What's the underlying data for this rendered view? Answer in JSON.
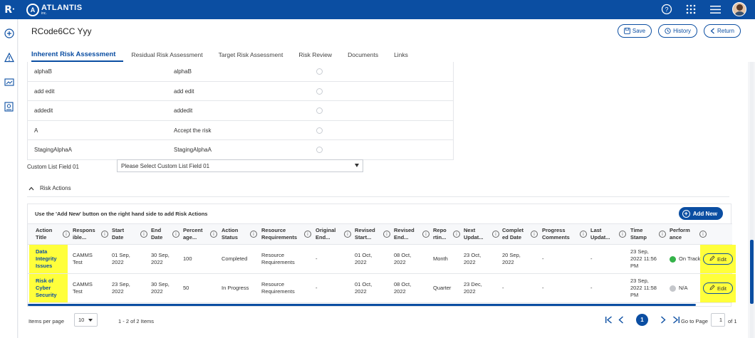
{
  "topbar": {
    "r_logo": "R",
    "brand_name": "ATLANTIS",
    "brand_sub": "inc.",
    "icons": [
      "help-icon",
      "apps-grid-icon",
      "menu-icon",
      "user-avatar"
    ]
  },
  "leftrail": {
    "icons": [
      "add-icon",
      "alert-icon",
      "chart-icon",
      "report-icon"
    ]
  },
  "header": {
    "title": "RCode6CC Yyy",
    "buttons": {
      "save": "Save",
      "history": "History",
      "return": "Return"
    }
  },
  "tabs": [
    {
      "label": "Inherent Risk Assessment",
      "active": true
    },
    {
      "label": "Residual Risk Assessment",
      "active": false
    },
    {
      "label": "Target Risk Assessment",
      "active": false
    },
    {
      "label": "Risk Review",
      "active": false
    },
    {
      "label": "Documents",
      "active": false
    },
    {
      "label": "Links",
      "active": false
    }
  ],
  "list_rows": [
    {
      "c1": "alphaB",
      "c2": "alphaB"
    },
    {
      "c1": "add edit",
      "c2": "add edit"
    },
    {
      "c1": "addedit",
      "c2": "addedit"
    },
    {
      "c1": "A",
      "c2": "Accept the risk"
    },
    {
      "c1": "StagingAlphaA",
      "c2": "StagingAlphaA"
    }
  ],
  "custom_field": {
    "label": "Custom List Field 01",
    "placeholder": "Please Select Custom List Field 01"
  },
  "risk_actions": {
    "section_title": "Risk Actions",
    "hint": "Use the 'Add New' button on the right hand side to add Risk Actions",
    "add_new_label": "Add New",
    "columns": [
      "Action Title",
      "Responsible...",
      "Start Date",
      "End Date",
      "Percentage...",
      "Action Status",
      "Resource Requirements",
      "Original End...",
      "Revised Start...",
      "Revised End...",
      "Reporting...",
      "Next Updat...",
      "Completed Date",
      "Progress Comments",
      "Last Updat...",
      "Time Stamp",
      "Performance"
    ],
    "column_lines": [
      [
        "Action",
        "Title"
      ],
      [
        "Respons",
        "ible..."
      ],
      [
        "Start",
        "Date"
      ],
      [
        "End",
        "Date"
      ],
      [
        "Percent",
        "age..."
      ],
      [
        "Action",
        "Status"
      ],
      [
        "Resource",
        "Requirements"
      ],
      [
        "Original",
        "End..."
      ],
      [
        "Revised",
        "Start..."
      ],
      [
        "Revised",
        "End..."
      ],
      [
        "Repo",
        "rtin..."
      ],
      [
        "Next",
        "Updat..."
      ],
      [
        "Complet",
        "ed Date"
      ],
      [
        "Progress",
        "Comments"
      ],
      [
        "Last",
        "Updat..."
      ],
      [
        "Time",
        "Stamp"
      ],
      [
        "Perform",
        "ance"
      ]
    ],
    "rows": [
      {
        "title_lines": [
          "Data",
          "Integrity",
          "Issues"
        ],
        "responsible_lines": [
          "CAMMS",
          "Test"
        ],
        "start_lines": [
          "01 Sep,",
          "2022"
        ],
        "end_lines": [
          "30 Sep,",
          "2022"
        ],
        "percentage": "100",
        "status": "Completed",
        "resource_lines": [
          "Resource",
          "Requirements"
        ],
        "original_end": "-",
        "revised_start_lines": [
          "01 Oct,",
          "2022"
        ],
        "revised_end_lines": [
          "08 Oct,",
          "2022"
        ],
        "reporting": "Month",
        "next_update_lines": [
          "23 Oct,",
          "2022"
        ],
        "completed_lines": [
          "20 Sep,",
          "2022"
        ],
        "progress_comments": "-",
        "last_update": "-",
        "timestamp_lines": [
          "23 Sep,",
          "2022 11:56",
          "PM"
        ],
        "performance": "On Track",
        "performance_color": "#35b34a",
        "edit_label": "Edit"
      },
      {
        "title_lines": [
          "Risk of",
          "Cyber",
          "Security"
        ],
        "responsible_lines": [
          "CAMMS",
          "Test"
        ],
        "start_lines": [
          "23 Sep,",
          "2022"
        ],
        "end_lines": [
          "30 Sep,",
          "2022"
        ],
        "percentage": "50",
        "status": "In Progress",
        "resource_lines": [
          "Resource",
          "Requirements"
        ],
        "original_end": "-",
        "revised_start_lines": [
          "01 Oct,",
          "2022"
        ],
        "revised_end_lines": [
          "08 Oct,",
          "2022"
        ],
        "reporting": "Quarter",
        "next_update_lines": [
          "23 Dec,",
          "2022"
        ],
        "completed_lines": [
          "-"
        ],
        "progress_comments": "-",
        "last_update": "-",
        "timestamp_lines": [
          "23 Sep,",
          "2022 11:58",
          "PM"
        ],
        "performance": "N/A",
        "performance_color": "#c5c7cb",
        "edit_label": "Edit"
      }
    ]
  },
  "pagination": {
    "items_per_page_label": "Items per page",
    "items_per_page_value": "10",
    "items_count": "1 - 2 of 2 Items",
    "current_page": "1",
    "go_to_page_label": "Go to Page",
    "go_to_page_value": "1",
    "of_label": "of 1"
  },
  "colors": {
    "primary": "#0b4ea2",
    "highlight": "#ffff3b"
  }
}
